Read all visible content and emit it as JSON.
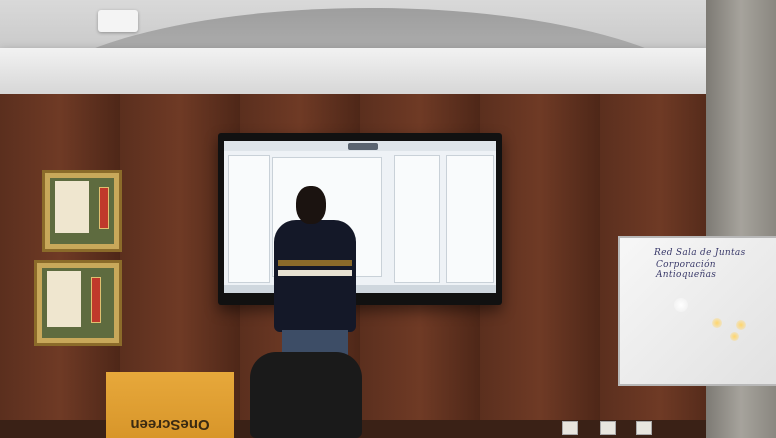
{
  "box_label": "OneScreen",
  "whiteboard": {
    "line1": "Red Sala de Juntas",
    "line2": "Corporación Antioqueñas"
  }
}
